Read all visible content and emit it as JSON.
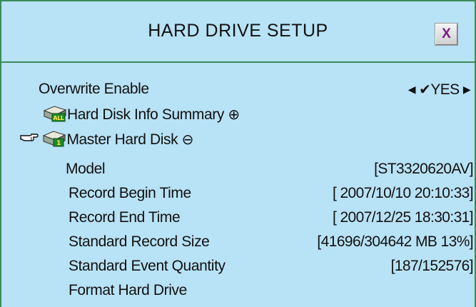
{
  "window": {
    "title": "HARD DRIVE SETUP",
    "close_label": "X"
  },
  "overwrite": {
    "label": "Overwrite Enable",
    "left_arrow": "◀",
    "check": "✔",
    "value": "YES",
    "right_arrow": "▶"
  },
  "info_summary": {
    "label": "Hard Disk Info Summary",
    "expand_symbol": "⊕",
    "icon_text": "ALL"
  },
  "master_disk": {
    "label": "Master Hard Disk",
    "collapse_symbol": "⊖",
    "icon_text": "1"
  },
  "details": {
    "model_label": "Model",
    "model_value": "[ST3320620AV]",
    "begin_label": "Record Begin Time",
    "begin_value": "[ 2007/10/10 20:10:33]",
    "end_label": "Record End Time",
    "end_value": "[ 2007/12/25 18:30:31]",
    "size_label": "Standard Record Size",
    "size_value": "[41696/304642 MB 13%]",
    "event_label": "Standard Event Quantity",
    "event_value": "[187/152576]",
    "format_label": "Format Hard Drive"
  },
  "colors": {
    "background": "#b8e2f5",
    "border": "#3c8a5a",
    "close_x": "#7a1a8a"
  },
  "icons": {
    "hdd": "hard-disk-icon",
    "pointer": "pointing-hand-icon"
  }
}
